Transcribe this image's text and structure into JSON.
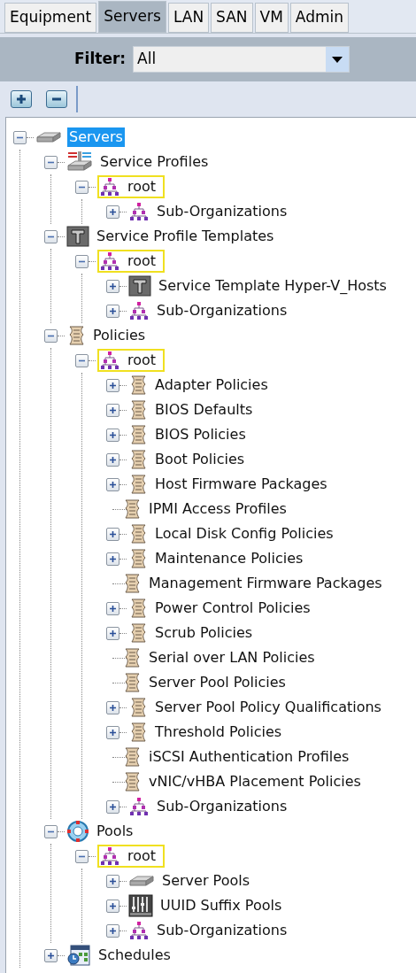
{
  "tabs": [
    {
      "label": "Equipment",
      "selected": false
    },
    {
      "label": "Servers",
      "selected": true
    },
    {
      "label": "LAN",
      "selected": false
    },
    {
      "label": "SAN",
      "selected": false
    },
    {
      "label": "VM",
      "selected": false
    },
    {
      "label": "Admin",
      "selected": false
    }
  ],
  "filter": {
    "label": "Filter:",
    "value": "All"
  },
  "tree": [
    {
      "label": "Servers",
      "kind": "server",
      "expanded": true,
      "selected": true,
      "highlighted": false,
      "children": [
        {
          "label": "Service Profiles",
          "kind": "profile",
          "expanded": true,
          "selected": false,
          "highlighted": false,
          "children": [
            {
              "label": "root",
              "kind": "org",
              "expanded": true,
              "selected": false,
              "highlighted": true,
              "children": [
                {
                  "label": "Sub-Organizations",
                  "kind": "org",
                  "expanded": false,
                  "selected": false,
                  "highlighted": false
                }
              ]
            }
          ]
        },
        {
          "label": "Service Profile Templates",
          "kind": "template",
          "expanded": true,
          "selected": false,
          "highlighted": false,
          "children": [
            {
              "label": "root",
              "kind": "org",
              "expanded": true,
              "selected": false,
              "highlighted": true,
              "children": [
                {
                  "label": "Service Template Hyper-V_Hosts",
                  "kind": "template",
                  "expanded": false,
                  "selected": false,
                  "highlighted": false
                },
                {
                  "label": "Sub-Organizations",
                  "kind": "org",
                  "expanded": false,
                  "selected": false,
                  "highlighted": false
                }
              ]
            }
          ]
        },
        {
          "label": "Policies",
          "kind": "policy",
          "expanded": true,
          "selected": false,
          "highlighted": false,
          "children": [
            {
              "label": "root",
              "kind": "org",
              "expanded": true,
              "selected": false,
              "highlighted": true,
              "children": [
                {
                  "label": "Adapter Policies",
                  "kind": "policy",
                  "expanded": false,
                  "selected": false,
                  "highlighted": false
                },
                {
                  "label": "BIOS Defaults",
                  "kind": "policy",
                  "expanded": false,
                  "selected": false,
                  "highlighted": false
                },
                {
                  "label": "BIOS Policies",
                  "kind": "policy",
                  "expanded": false,
                  "selected": false,
                  "highlighted": false
                },
                {
                  "label": "Boot Policies",
                  "kind": "policy",
                  "expanded": false,
                  "selected": false,
                  "highlighted": false
                },
                {
                  "label": "Host Firmware Packages",
                  "kind": "policy",
                  "expanded": false,
                  "selected": false,
                  "highlighted": false
                },
                {
                  "label": "IPMI Access Profiles",
                  "kind": "policy",
                  "selected": false,
                  "highlighted": false
                },
                {
                  "label": "Local Disk Config Policies",
                  "kind": "policy",
                  "expanded": false,
                  "selected": false,
                  "highlighted": false
                },
                {
                  "label": "Maintenance Policies",
                  "kind": "policy",
                  "expanded": false,
                  "selected": false,
                  "highlighted": false
                },
                {
                  "label": "Management Firmware Packages",
                  "kind": "policy",
                  "selected": false,
                  "highlighted": false
                },
                {
                  "label": "Power Control Policies",
                  "kind": "policy",
                  "expanded": false,
                  "selected": false,
                  "highlighted": false
                },
                {
                  "label": "Scrub Policies",
                  "kind": "policy",
                  "expanded": false,
                  "selected": false,
                  "highlighted": false
                },
                {
                  "label": "Serial over LAN Policies",
                  "kind": "policy",
                  "selected": false,
                  "highlighted": false
                },
                {
                  "label": "Server Pool Policies",
                  "kind": "policy",
                  "selected": false,
                  "highlighted": false
                },
                {
                  "label": "Server Pool Policy Qualifications",
                  "kind": "policy",
                  "expanded": false,
                  "selected": false,
                  "highlighted": false
                },
                {
                  "label": "Threshold Policies",
                  "kind": "policy",
                  "expanded": false,
                  "selected": false,
                  "highlighted": false
                },
                {
                  "label": "iSCSI Authentication Profiles",
                  "kind": "policy",
                  "selected": false,
                  "highlighted": false
                },
                {
                  "label": "vNIC/vHBA Placement Policies",
                  "kind": "policy",
                  "selected": false,
                  "highlighted": false
                },
                {
                  "label": "Sub-Organizations",
                  "kind": "org",
                  "expanded": false,
                  "selected": false,
                  "highlighted": false
                }
              ]
            }
          ]
        },
        {
          "label": "Pools",
          "kind": "pools",
          "expanded": true,
          "selected": false,
          "highlighted": false,
          "children": [
            {
              "label": "root",
              "kind": "org",
              "expanded": true,
              "selected": false,
              "highlighted": true,
              "children": [
                {
                  "label": "Server Pools",
                  "kind": "server",
                  "expanded": false,
                  "selected": false,
                  "highlighted": false
                },
                {
                  "label": "UUID Suffix Pools",
                  "kind": "uuid",
                  "expanded": false,
                  "selected": false,
                  "highlighted": false
                },
                {
                  "label": "Sub-Organizations",
                  "kind": "org",
                  "expanded": false,
                  "selected": false,
                  "highlighted": false
                }
              ]
            }
          ]
        },
        {
          "label": "Schedules",
          "kind": "schedule",
          "expanded": false,
          "selected": false,
          "highlighted": false
        }
      ]
    }
  ]
}
